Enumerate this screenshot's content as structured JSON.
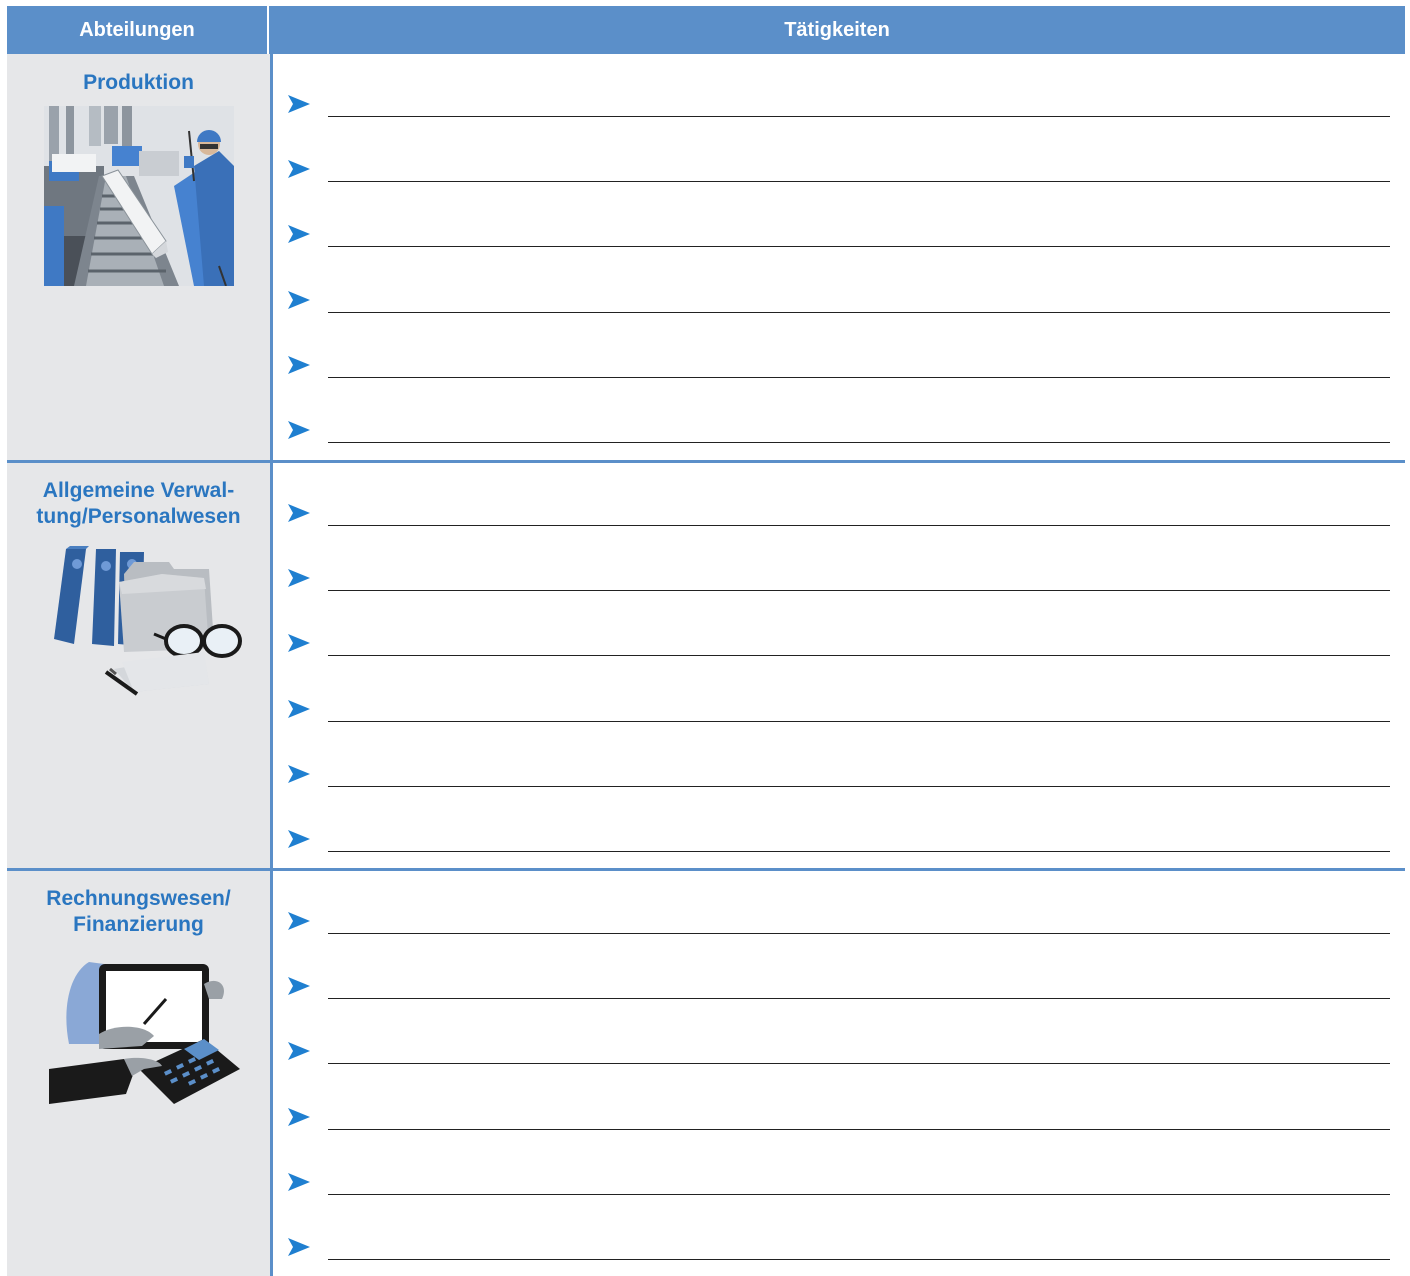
{
  "header": {
    "departments_label": "Abteilungen",
    "activities_label": "Tätigkeiten"
  },
  "departments": [
    {
      "title_line1": "Produktion",
      "title_line2": "",
      "illustration": "factory-worker-conveyor",
      "answer_lines": 6
    },
    {
      "title_line1": "Allgemeine Verwal-",
      "title_line2": "tung/Personalwesen",
      "illustration": "binders-folder-glasses-pen",
      "answer_lines": 6
    },
    {
      "title_line1": "Rechnungswesen/",
      "title_line2": "Finanzierung",
      "illustration": "tablet-and-calculator",
      "answer_lines": 6
    }
  ],
  "colors": {
    "header_blue": "#5b8fc9",
    "title_blue": "#2a76c0",
    "bullet_blue": "#1f7fd0",
    "left_column_gray": "#e6e7e9"
  },
  "bullet_icon": "arrowhead-bullet-icon"
}
